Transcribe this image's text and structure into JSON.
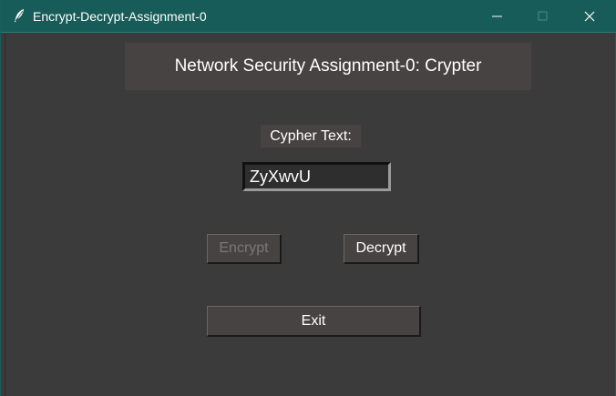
{
  "window": {
    "title": "Encrypt-Decrypt-Assignment-0",
    "icon": "feather-icon",
    "title_bar_color": "#175c58",
    "background_color": "#3c3b3b"
  },
  "header": {
    "title": "Network Security Assignment-0: Crypter"
  },
  "form": {
    "label": "Cypher Text:",
    "input_value": "ZyXwvU"
  },
  "buttons": {
    "encrypt": {
      "label": "Encrypt",
      "state": "disabled"
    },
    "decrypt": {
      "label": "Decrypt",
      "state": "enabled"
    },
    "exit": {
      "label": "Exit",
      "state": "enabled"
    }
  }
}
